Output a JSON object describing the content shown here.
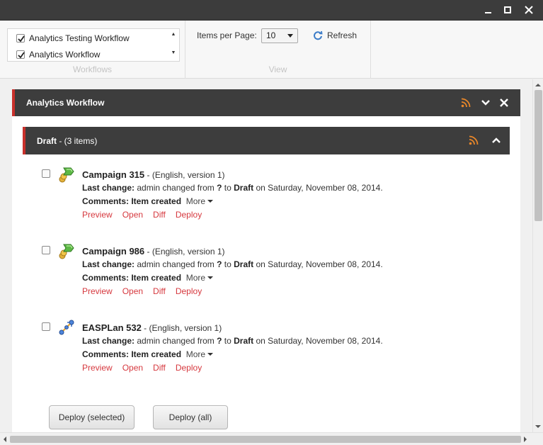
{
  "window": {
    "minimize_icon": "minimize-icon",
    "maximize_icon": "maximize-icon",
    "close_icon": "close-icon"
  },
  "ribbon": {
    "workflows": {
      "label": "Workflows",
      "items": [
        {
          "label": "Analytics Testing Workflow",
          "checked": true
        },
        {
          "label": "Analytics Workflow",
          "checked": true
        }
      ]
    },
    "view": {
      "label": "View",
      "items_per_page_label": "Items per Page:",
      "items_per_page_value": "10",
      "refresh_label": "Refresh"
    }
  },
  "panel": {
    "title": "Analytics Workflow",
    "accent_color": "#c8302b",
    "header_color": "#3d3d3d",
    "state": {
      "name": "Draft",
      "count_text": " - (3 items)"
    },
    "items": [
      {
        "name": "Campaign 315",
        "meta": " - (English, version 1)",
        "type_icon": "campaign-icon",
        "last_change_label": "Last change:",
        "last_change_pre": " admin changed from ",
        "from_state": "?",
        "to_word": " to ",
        "to_state": "Draft",
        "date_text": " on Saturday, November 08, 2014.",
        "comments_label": "Comments:",
        "comments_value": " Item created",
        "more_label": "More",
        "actions": [
          "Preview",
          "Open",
          "Diff",
          "Deploy"
        ]
      },
      {
        "name": "Campaign 986",
        "meta": " - (English, version 1)",
        "type_icon": "campaign-icon",
        "last_change_label": "Last change:",
        "last_change_pre": " admin changed from ",
        "from_state": "?",
        "to_word": " to ",
        "to_state": "Draft",
        "date_text": " on Saturday, November 08, 2014.",
        "comments_label": "Comments:",
        "comments_value": " Item created",
        "more_label": "More",
        "actions": [
          "Preview",
          "Open",
          "Diff",
          "Deploy"
        ]
      },
      {
        "name": "EASPLan 532",
        "meta": " - (English, version 1)",
        "type_icon": "plan-icon",
        "last_change_label": "Last change:",
        "last_change_pre": " admin changed from ",
        "from_state": "?",
        "to_word": " to ",
        "to_state": "Draft",
        "date_text": " on Saturday, November 08, 2014.",
        "comments_label": "Comments:",
        "comments_value": " Item created",
        "more_label": "More",
        "actions": [
          "Preview",
          "Open",
          "Diff",
          "Deploy"
        ]
      }
    ],
    "deploy_selected_label": "Deploy (selected)",
    "deploy_all_label": "Deploy (all)"
  }
}
